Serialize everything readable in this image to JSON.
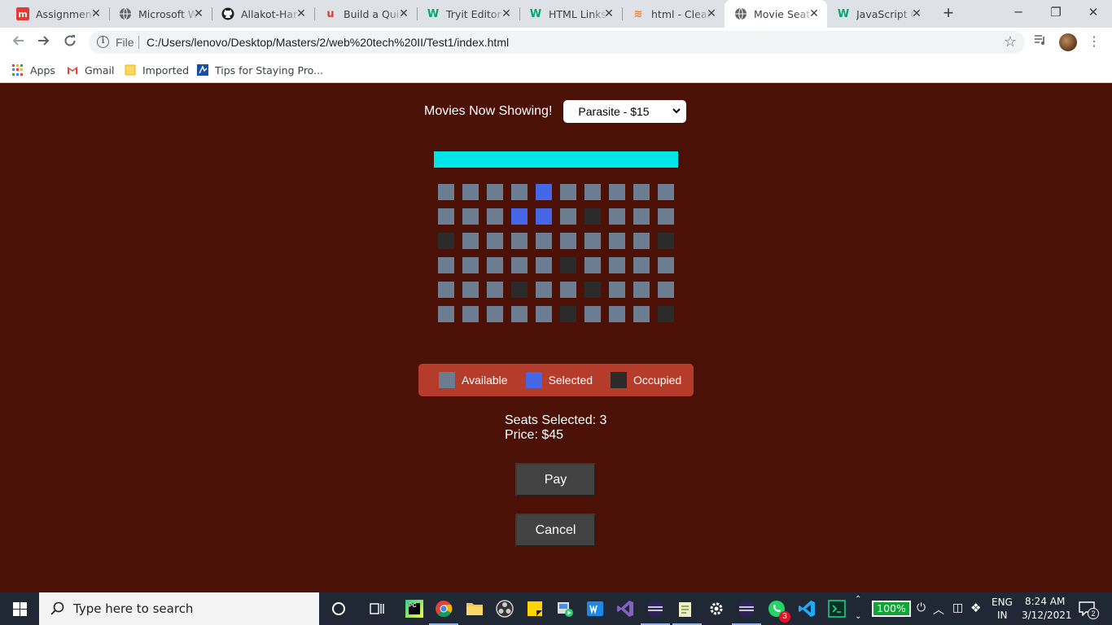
{
  "browser": {
    "tabs": [
      {
        "title": "Assignment",
        "icon": "mindomo-icon",
        "color": "#e53935",
        "glyph": "m"
      },
      {
        "title": "Microsoft W",
        "icon": "globe-icon",
        "color": "#5f6368",
        "glyph": ""
      },
      {
        "title": "Allakot-Har",
        "icon": "github-icon",
        "color": "#202124",
        "glyph": ""
      },
      {
        "title": "Build a Quiz",
        "icon": "udemy-icon",
        "color": "#e53935",
        "glyph": "u"
      },
      {
        "title": "Tryit Editor",
        "icon": "w3schools-icon",
        "color": "#04aa6d",
        "glyph": "W"
      },
      {
        "title": "HTML Links",
        "icon": "w3schools-icon",
        "color": "#04aa6d",
        "glyph": "W"
      },
      {
        "title": "html - Clear",
        "icon": "stackoverflow-icon",
        "color": "#f48024",
        "glyph": "≋"
      },
      {
        "title": "Movie Seat",
        "icon": "globe-icon",
        "color": "#5f6368",
        "glyph": ""
      },
      {
        "title": "JavaScript C",
        "icon": "w3schools-icon",
        "color": "#04aa6d",
        "glyph": "W"
      }
    ],
    "active_tab": 7,
    "address": {
      "scheme_label": "File",
      "url": "C:/Users/lenovo/Desktop/Masters/2/web%20tech%20II/Test1/index.html"
    },
    "bookmarks": [
      {
        "label": "Apps",
        "icon": "apps-grid-icon"
      },
      {
        "label": "Gmail",
        "icon": "gmail-icon"
      },
      {
        "label": "Imported",
        "icon": "folder-icon"
      },
      {
        "label": "Tips for Staying Pro...",
        "icon": "bookmark-page-icon"
      }
    ]
  },
  "app": {
    "movie_label": "Movies Now Showing!",
    "movie_selected": "Parasite - $15",
    "seat_rows": [
      [
        "available",
        "available",
        "available",
        "available",
        "selected",
        "available",
        "available",
        "available",
        "available",
        "available"
      ],
      [
        "available",
        "available",
        "available",
        "selected",
        "selected",
        "available",
        "occupied",
        "available",
        "available",
        "available"
      ],
      [
        "occupied",
        "available",
        "available",
        "available",
        "available",
        "available",
        "available",
        "available",
        "available",
        "occupied"
      ],
      [
        "available",
        "available",
        "available",
        "available",
        "available",
        "occupied",
        "available",
        "available",
        "available",
        "available"
      ],
      [
        "available",
        "available",
        "available",
        "occupied",
        "available",
        "available",
        "occupied",
        "available",
        "available",
        "available"
      ],
      [
        "available",
        "available",
        "available",
        "available",
        "available",
        "occupied",
        "available",
        "available",
        "available",
        "occupied"
      ]
    ],
    "legend": [
      {
        "label": "Available",
        "color": "#6d7d91"
      },
      {
        "label": "Selected",
        "color": "#4566e5"
      },
      {
        "label": "Occupied",
        "color": "#2b2b2b"
      }
    ],
    "seats_selected_text": "Seats Selected: 3",
    "price_text": "Price: $45",
    "pay_label": "Pay",
    "cancel_label": "Cancel",
    "colors": {
      "background": "#4b1006",
      "screen": "#00e5e8",
      "legend_bg": "#b53b2b",
      "button_bg": "#424242"
    }
  },
  "taskbar": {
    "search_placeholder": "Type here to search",
    "battery": "100%",
    "language": "ENG",
    "region": "IN",
    "time": "8:24 AM",
    "date": "3/12/2021",
    "whatsapp_badge": "3",
    "notification_count": "2"
  }
}
